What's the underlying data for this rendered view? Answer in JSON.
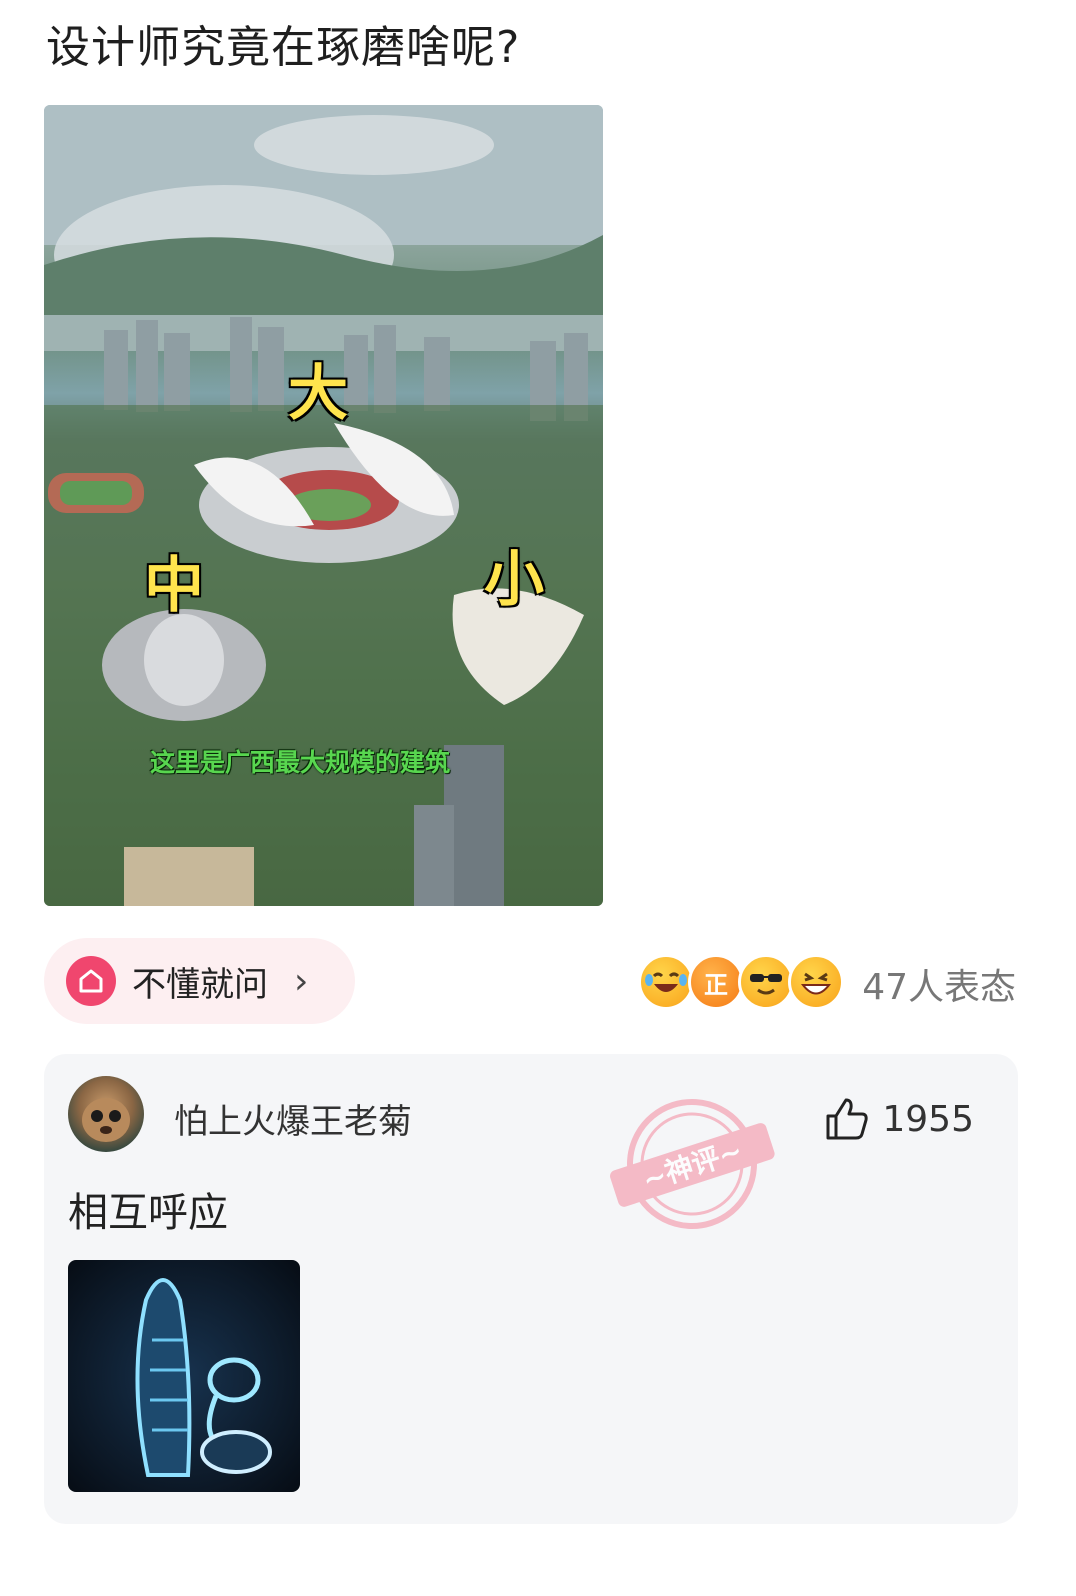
{
  "post": {
    "title": "设计师究竟在琢磨啥呢?",
    "image_overlay": {
      "big": "大",
      "medium": "中",
      "small": "小",
      "caption": "这里是广西最大规模的建筑"
    }
  },
  "topic": {
    "label": "不懂就问",
    "icon": "home-icon",
    "arrow": "›"
  },
  "reactions": {
    "emojis": [
      "laughing-crying-emoji",
      "zheng-badge-emoji",
      "sunglasses-emoji",
      "grinning-emoji"
    ],
    "zheng_text": "正",
    "count_text": "47人表态"
  },
  "comment": {
    "username": "怕上火爆王老菊",
    "likes": "1955",
    "text": "相互呼应",
    "stamp_text": "~神评~",
    "colors": {
      "stamp": "#f4a6b6",
      "accent": "#f0466e"
    }
  }
}
